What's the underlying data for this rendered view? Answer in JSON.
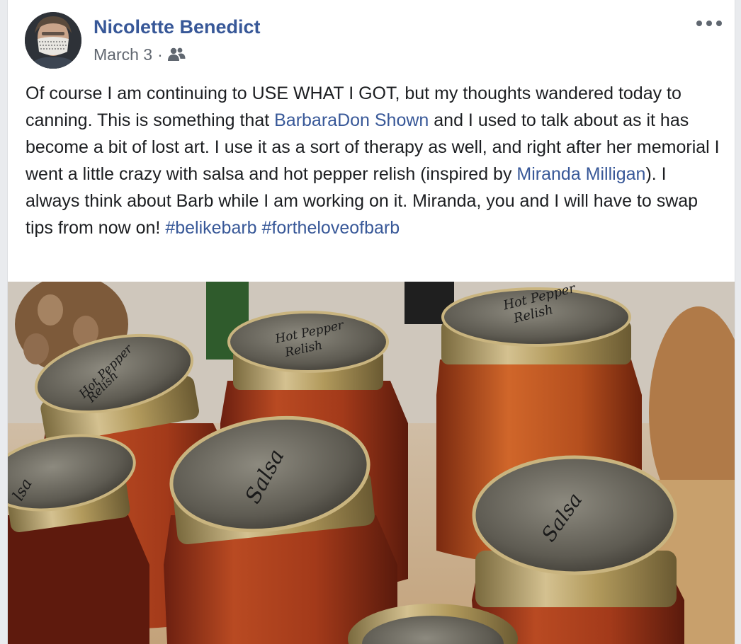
{
  "post": {
    "author": "Nicolette Benedict",
    "date": "March 3",
    "separator": "·",
    "audience_icon": "friends-icon",
    "more_icon": "more-options-icon",
    "text": {
      "t1": "Of course I am continuing to USE WHAT I GOT, but my thoughts wandered today to canning. This is something that ",
      "mention1": "BarbaraDon Shown",
      "t2": " and I used to talk about as it has become a bit of lost art. I use it as a sort of therapy as well, and right after her memorial I went a little crazy with salsa and hot pepper relish (inspired by ",
      "mention2": "Miranda Milligan",
      "t3": "). I always think about Barb while I am working on it. Miranda, you and I will have to swap tips from now on! ",
      "hashtag1": "#belikebarb",
      "space": " ",
      "hashtag2": "#fortheloveofbarb"
    },
    "photo": {
      "jar_labels": [
        "Hot Pepper Relish",
        "Hot Pepper Relish",
        "Hot Pepper Relish",
        "lsa",
        "Salsa",
        "Salsa"
      ]
    }
  },
  "colors": {
    "link": "#385898",
    "text": "#1c1e21",
    "meta": "#616770",
    "salsa": "#a3361a",
    "lid": "#b29a5c"
  }
}
